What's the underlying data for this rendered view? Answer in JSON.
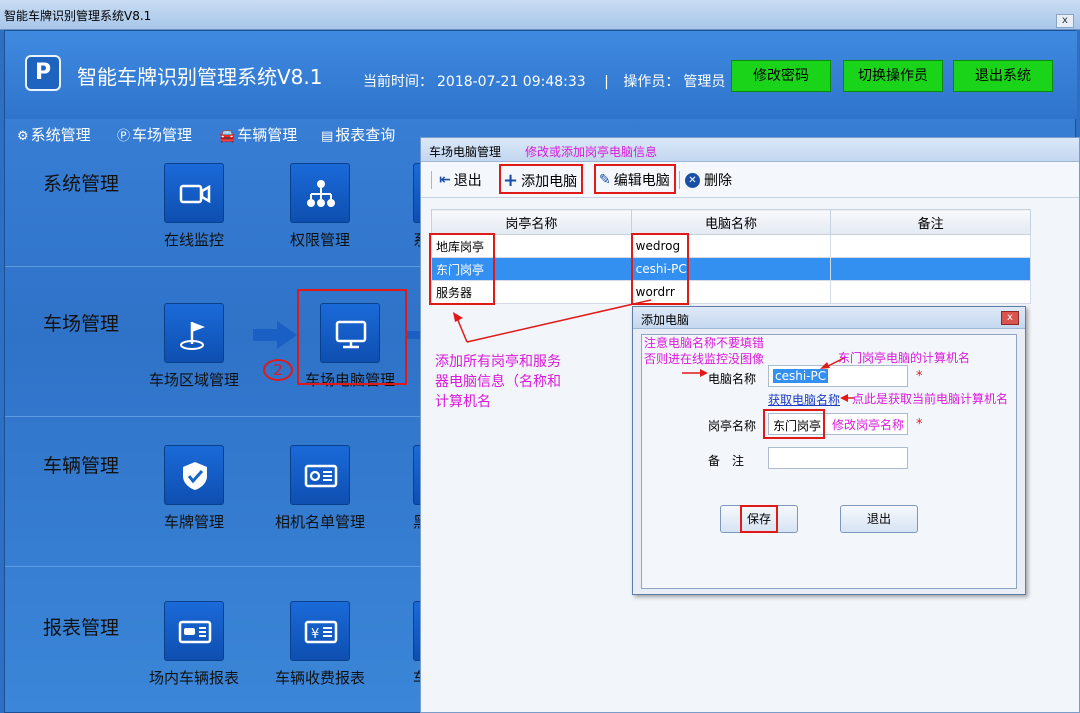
{
  "window": {
    "title": "智能车牌识别管理系统V8.1",
    "close_glyph": "x"
  },
  "header": {
    "logo": "P",
    "app_title": "智能车牌识别管理系统V8.1",
    "time_label": "当前时间：",
    "time_value": "2018-07-21 09:48:33",
    "separator": "|",
    "operator_label": "操作员：",
    "operator_value": "管理员",
    "buttons": {
      "change_password": "修改密码",
      "switch_operator": "切换操作员",
      "exit": "退出系统"
    }
  },
  "menu": {
    "items": [
      "系统管理",
      "车场管理",
      "车辆管理",
      "报表查询"
    ]
  },
  "sections": {
    "system": {
      "title": "系统管理",
      "tiles": [
        "在线监控",
        "权限管理",
        "系"
      ]
    },
    "parking": {
      "title": "车场管理",
      "tiles": [
        "车场区域管理",
        "车场电脑管理"
      ],
      "step_marker": "2"
    },
    "vehicle": {
      "title": "车辆管理",
      "tiles": [
        "车牌管理",
        "相机名单管理",
        "黑"
      ]
    },
    "report": {
      "title": "报表管理",
      "tiles": [
        "场内车辆报表",
        "车辆收费报表",
        "车"
      ]
    }
  },
  "pc_dialog": {
    "title": "车场电脑管理",
    "note": "修改或添加岗亭电脑信息",
    "toolbar": {
      "exit": "退出",
      "add": "添加电脑",
      "edit": "编辑电脑",
      "delete": "删除"
    },
    "columns": [
      "岗亭名称",
      "电脑名称",
      "备注"
    ],
    "rows": [
      {
        "booth": "地库岗亭",
        "pc": "wedrog",
        "remark": ""
      },
      {
        "booth": "东门岗亭",
        "pc": "ceshi-PC",
        "remark": ""
      },
      {
        "booth": "服务器",
        "pc": "wordrr",
        "remark": ""
      }
    ],
    "annotation_lines": [
      "添加所有岗亭和服务",
      "器电脑信息（名称和",
      "计算机名"
    ]
  },
  "add_dialog": {
    "title": "添加电脑",
    "close_glyph": "x",
    "warning_lines": [
      "注意电脑名称不要填错",
      "否则进在线监控没图像"
    ],
    "pc_name_label": "电脑名称",
    "pc_name_value": "ceshi-PC",
    "pc_name_note": "东门岗亭电脑的计算机名",
    "get_name_link": "获取电脑名称",
    "get_name_note": "点此是获取当前电脑计算机名",
    "booth_label": "岗亭名称",
    "booth_value": "东门岗亭",
    "booth_note": "修改岗亭名称",
    "remark_label": "备　注",
    "remark_value": "",
    "required_mark": "*",
    "save": "保存",
    "exit": "退出"
  },
  "colors": {
    "accent_green": "#19d419",
    "highlight_red": "#e01919",
    "annotation_pink": "#d91ad9",
    "selection_blue": "#3390f0"
  }
}
